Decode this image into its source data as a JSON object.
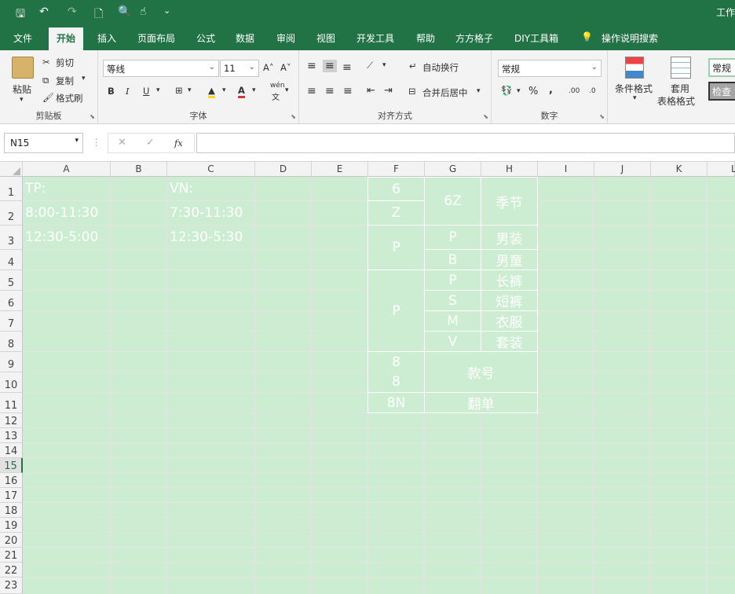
{
  "title_bar": {
    "title": "工作",
    "save_icon": "🖫",
    "undo_icon": "↶",
    "redo_icon": "↷",
    "new_icon": "🗋",
    "preview_icon": "🔍",
    "touch_icon": "☝",
    "customize_icon": "⌄"
  },
  "menu": {
    "tabs": [
      "文件",
      "开始",
      "插入",
      "页面布局",
      "公式",
      "数据",
      "审阅",
      "视图",
      "开发工具",
      "帮助",
      "方方格子",
      "DIY工具箱"
    ],
    "active_tab": "开始",
    "search": "操作说明搜索",
    "search_icon": "💡"
  },
  "ribbon": {
    "clipboard": {
      "paste": "粘贴",
      "cut": "剪切",
      "copy": "复制",
      "format_painter": "格式刷",
      "label": "剪贴板"
    },
    "font": {
      "name": "等线",
      "size": "11",
      "grow": "A˄",
      "shrink": "A˅",
      "bold": "B",
      "italic": "I",
      "underline": "U",
      "wen": "wén",
      "wen2": "文",
      "label": "字体"
    },
    "alignment": {
      "wrap": "自动换行",
      "merge": "合并后居中",
      "label": "对齐方式"
    },
    "number": {
      "format": "常规",
      "percent": "%",
      "comma": ",",
      "inc": ".00",
      "dec": ".0",
      "label": "数字"
    },
    "styles": {
      "conditional": "条件格式",
      "table_format_1": "套用",
      "table_format_2": "表格格式",
      "normal": "常规",
      "check": "检查"
    }
  },
  "formula_bar": {
    "name_box": "N15",
    "cancel": "✕",
    "enter": "✓",
    "fx": "fx",
    "content": ""
  },
  "columns": [
    "A",
    "B",
    "C",
    "D",
    "E",
    "F",
    "G",
    "H",
    "I",
    "J",
    "K",
    "L"
  ],
  "rows": [
    "1",
    "2",
    "3",
    "4",
    "5",
    "6",
    "7",
    "8",
    "9",
    "10",
    "11",
    "12",
    "13",
    "14",
    "15",
    "16",
    "17",
    "18",
    "19",
    "20",
    "21",
    "22",
    "23"
  ],
  "selected_row": "15",
  "cells": {
    "A1": "TP:",
    "A2": "8:00-11:30",
    "A3": "12:30-5:00",
    "C1": "VN:",
    "C2": "7:30-11:30",
    "C3": "12:30-5:30"
  },
  "table": {
    "F1": "6",
    "F2": "Z",
    "G12": "6Z",
    "H12": "季节",
    "F34": "P",
    "G3": "P",
    "H3": "男装",
    "G4": "B",
    "H4": "男童",
    "F58": "P",
    "G5": "P",
    "H5": "长裤",
    "G6": "S",
    "H6": "短裤",
    "G7": "M",
    "H7": "衣服",
    "G8": "V",
    "H8": "套装",
    "F9": "8",
    "F10": "8",
    "G910": "款号",
    "F11": "8N",
    "G11": "翻单"
  },
  "colors": {
    "excel_green": "#217346",
    "sheet_bg": "#cdedd2"
  }
}
